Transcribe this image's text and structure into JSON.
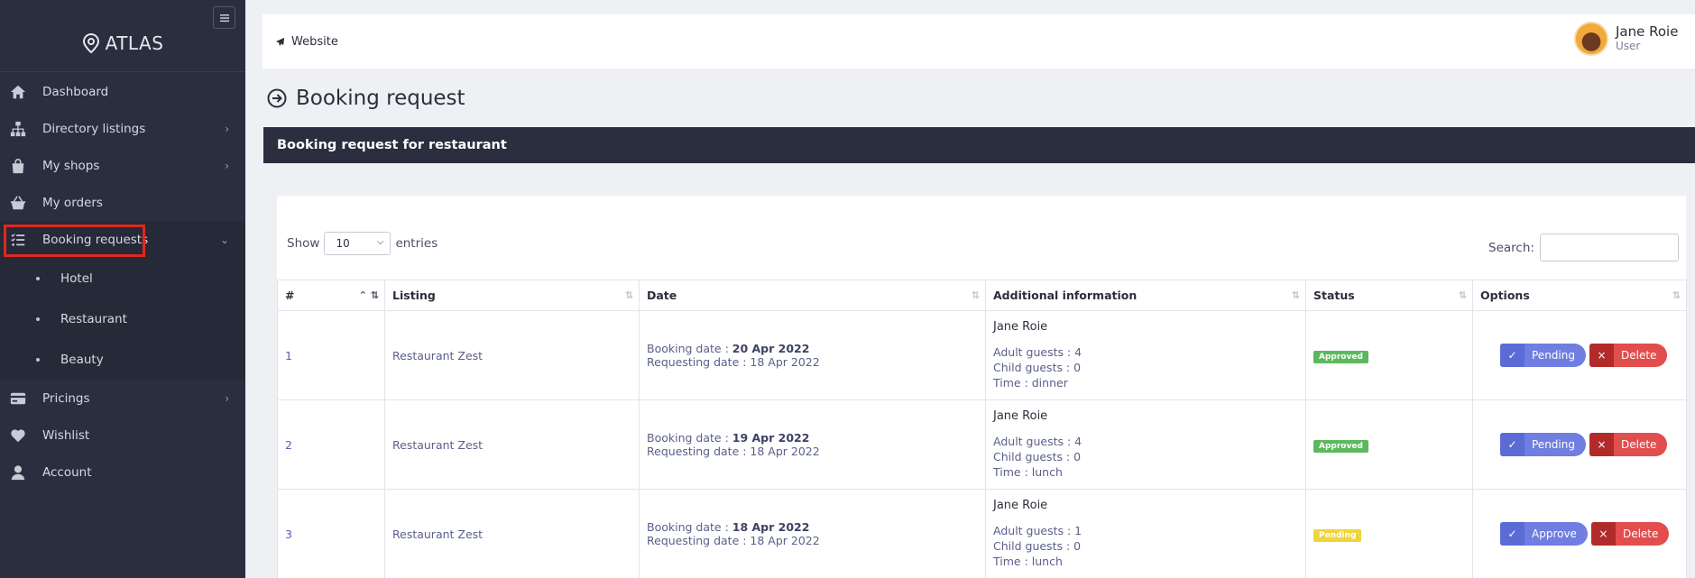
{
  "brand": {
    "name": "ATLAS"
  },
  "sidebar": {
    "items": [
      {
        "label": "Dashboard",
        "icon": "home-icon"
      },
      {
        "label": "Directory listings",
        "icon": "sitemap-icon",
        "chevron": "›"
      },
      {
        "label": "My shops",
        "icon": "bag-icon",
        "chevron": "›"
      },
      {
        "label": "My orders",
        "icon": "basket-icon"
      },
      {
        "label": "Booking requests",
        "icon": "list-check-icon",
        "chevron": "⌄"
      },
      {
        "label": "Pricings",
        "icon": "credit-card-icon",
        "chevron": "›"
      },
      {
        "label": "Wishlist",
        "icon": "heart-icon"
      },
      {
        "label": "Account",
        "icon": "user-icon"
      }
    ],
    "sub_items": [
      "Hotel",
      "Restaurant",
      "Beauty"
    ]
  },
  "header": {
    "website_label": "Website",
    "user_name": "Jane Roie",
    "user_role": "User"
  },
  "page": {
    "title": "Booking request",
    "card_title": "Booking request for restaurant"
  },
  "table_controls": {
    "show_label": "Show",
    "entries_value": "10",
    "entries_label": "entries",
    "search_label": "Search:"
  },
  "table": {
    "columns": [
      "#",
      "Listing",
      "Date",
      "Additional information",
      "Status",
      "Options"
    ],
    "rows": [
      {
        "num": "1",
        "listing": "Restaurant Zest",
        "booking_prefix": "Booking date : ",
        "booking_date": "20 Apr 2022",
        "requesting": "Requesting date : 18 Apr 2022",
        "name": "Jane Roie",
        "adults": "Adult guests : 4",
        "children": "Child guests : 0",
        "time": "Time : dinner",
        "status": "Approved",
        "action": "Pending",
        "delete": "Delete"
      },
      {
        "num": "2",
        "listing": "Restaurant Zest",
        "booking_prefix": "Booking date : ",
        "booking_date": "19 Apr 2022",
        "requesting": "Requesting date : 18 Apr 2022",
        "name": "Jane Roie",
        "adults": "Adult guests : 4",
        "children": "Child guests : 0",
        "time": "Time : lunch",
        "status": "Approved",
        "action": "Pending",
        "delete": "Delete"
      },
      {
        "num": "3",
        "listing": "Restaurant Zest",
        "booking_prefix": "Booking date : ",
        "booking_date": "18 Apr 2022",
        "requesting": "Requesting date : 18 Apr 2022",
        "name": "Jane Roie",
        "adults": "Adult guests : 1",
        "children": "Child guests : 0",
        "time": "Time : lunch",
        "status": "Pending",
        "action": "Approve",
        "delete": "Delete"
      }
    ]
  },
  "colors": {
    "sidebar_bg": "#2b2e3e",
    "highlight_box": "#e0281b",
    "approved": "#5cb85c",
    "pending": "#f0d43c",
    "primary_btn": "#6f7ee0",
    "danger_btn": "#e24d4d"
  }
}
